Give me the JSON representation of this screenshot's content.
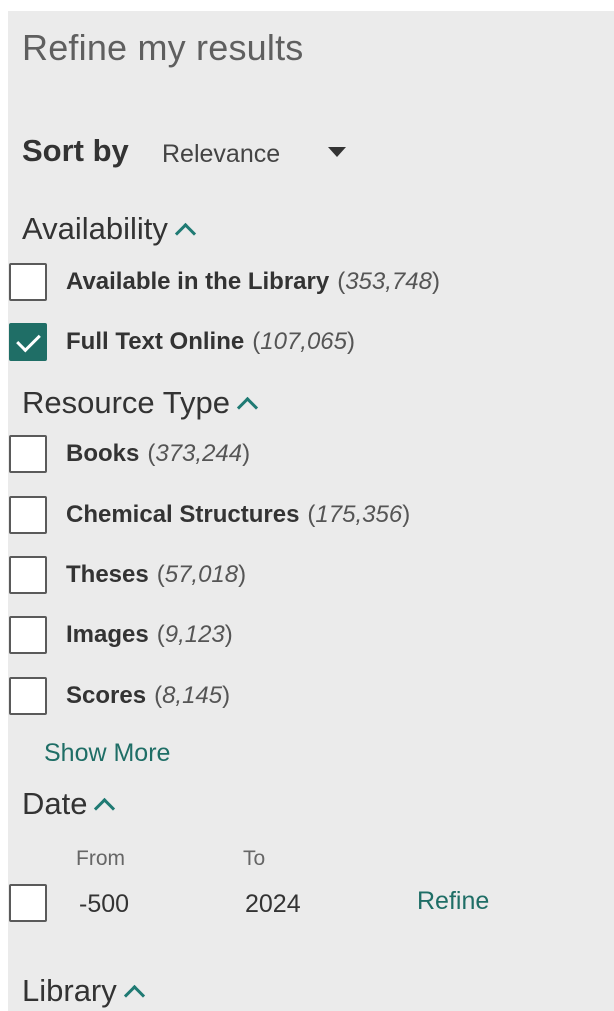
{
  "title": "Refine my results",
  "sort": {
    "label": "Sort by",
    "value": "Relevance"
  },
  "availability": {
    "heading": "Availability",
    "items": [
      {
        "label": "Available in the Library",
        "count": "353,748",
        "checked": false
      },
      {
        "label": "Full Text Online",
        "count": "107,065",
        "checked": true
      }
    ]
  },
  "resource_type": {
    "heading": "Resource Type",
    "items": [
      {
        "label": "Books",
        "count": "373,244"
      },
      {
        "label": "Chemical Structures",
        "count": "175,356"
      },
      {
        "label": "Theses",
        "count": "57,018"
      },
      {
        "label": "Images",
        "count": "9,123"
      },
      {
        "label": "Scores",
        "count": "8,145"
      }
    ],
    "show_more": "Show More"
  },
  "date": {
    "heading": "Date",
    "from_label": "From",
    "to_label": "To",
    "from_value": "-500",
    "to_value": "2024",
    "refine": "Refine"
  },
  "library": {
    "heading": "Library"
  },
  "colors": {
    "accent": "#1f6e66",
    "panel_bg": "#ebebeb"
  }
}
